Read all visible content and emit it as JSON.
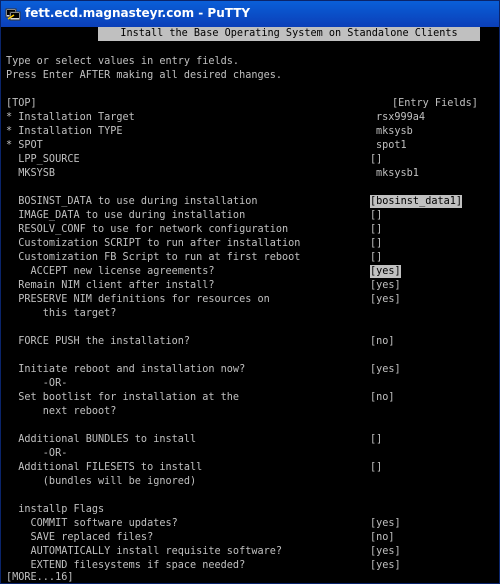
{
  "window": {
    "title": "fett.ecd.magnasteyr.com - PuTTY"
  },
  "screen": {
    "heading": "Install the Base Operating System on Standalone Clients",
    "instructions": [
      "Type or select values in entry fields.",
      "Press Enter AFTER making all desired changes."
    ],
    "top_marker": "[TOP]",
    "entry_fields_header": "[Entry Fields]",
    "fields": [
      {
        "label": "* Installation Target",
        "value": "rsx999a4"
      },
      {
        "label": "* Installation TYPE",
        "value": "mksysb"
      },
      {
        "label": "* SPOT",
        "value": "spot1"
      },
      {
        "label": "  LPP_SOURCE",
        "value": "[]"
      },
      {
        "label": "  MKSYSB",
        "value": "mksysb1"
      },
      {
        "label": "  BOSINST_DATA to use during installation",
        "value": "[bosinst_data1]"
      },
      {
        "label": "  IMAGE_DATA to use during installation",
        "value": "[]"
      },
      {
        "label": "  RESOLV_CONF to use for network configuration",
        "value": "[]"
      },
      {
        "label": "  Customization SCRIPT to run after installation",
        "value": "[]"
      },
      {
        "label": "  Customization FB Script to run at first reboot",
        "value": "[]"
      },
      {
        "label": "    ACCEPT new license agreements?",
        "value": "[yes]"
      },
      {
        "label": "  Remain NIM client after install?",
        "value": "[yes]"
      },
      {
        "label": "  PRESERVE NIM definitions for resources on",
        "value": "[yes]"
      },
      {
        "label": "      this target?",
        "value": ""
      },
      {
        "label": "  FORCE PUSH the installation?",
        "value": "[no]"
      },
      {
        "label": "  Initiate reboot and installation now?",
        "value": "[yes]"
      },
      {
        "label": "      -OR-",
        "value": ""
      },
      {
        "label": "  Set bootlist for installation at the",
        "value": "[no]"
      },
      {
        "label": "      next reboot?",
        "value": ""
      },
      {
        "label": "  Additional BUNDLES to install",
        "value": "[]"
      },
      {
        "label": "      -OR-",
        "value": ""
      },
      {
        "label": "  Additional FILESETS to install",
        "value": "[]"
      },
      {
        "label": "      (bundles will be ignored)",
        "value": ""
      },
      {
        "label": "  installp Flags",
        "value": ""
      },
      {
        "label": "    COMMIT software updates?",
        "value": "[yes]"
      },
      {
        "label": "    SAVE replaced files?",
        "value": "[no]"
      },
      {
        "label": "    AUTOMATICALLY install requisite software?",
        "value": "[yes]"
      },
      {
        "label": "    EXTEND filesystems if space needed?",
        "value": "[yes]"
      }
    ],
    "more_marker": "[MORE...16]"
  },
  "colors": {
    "terminal_bg": "#000000",
    "terminal_fg": "#c0c0c0",
    "titlebar": "#0b4fd0"
  },
  "icons": {
    "window_icon": "putty-icon"
  }
}
